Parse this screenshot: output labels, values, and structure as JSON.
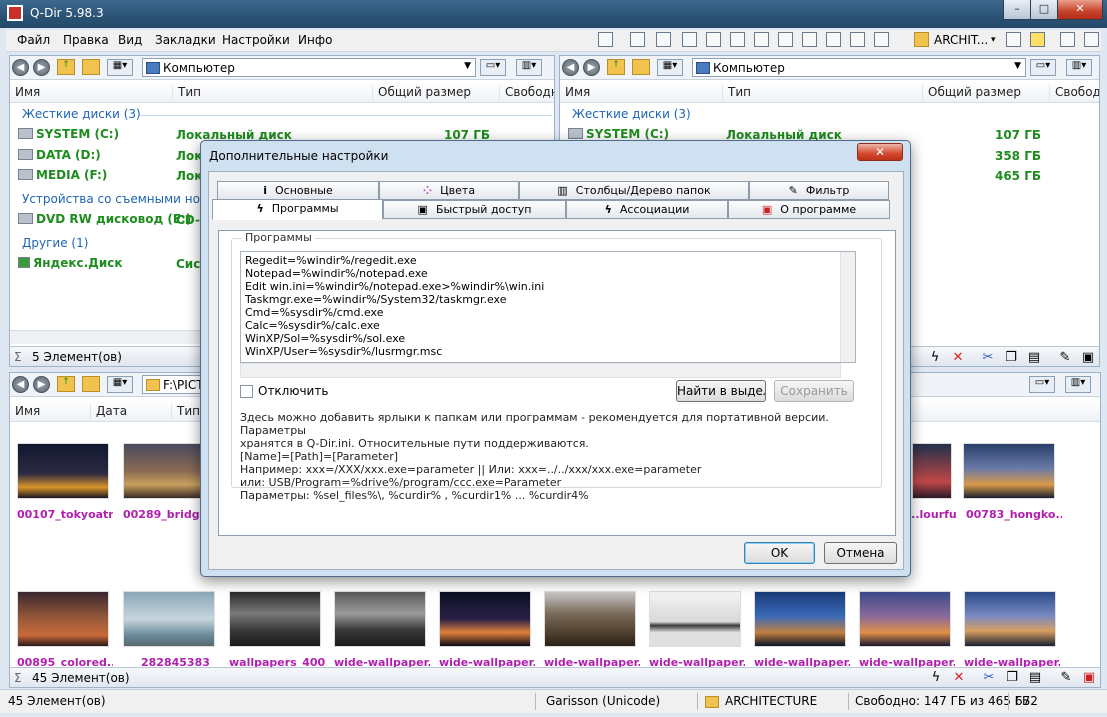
{
  "window": {
    "title": "Q-Dir 5.98.3",
    "buttons": [
      "–",
      "□",
      "✕"
    ]
  },
  "menu": [
    "Файл",
    "Правка",
    "Вид",
    "Закладки",
    "Настройки",
    "Инфо"
  ],
  "toolbar": {
    "folder_label": "ARCHIT...",
    "dropdown": "▾"
  },
  "pane_left_top": {
    "address": "Компьютер",
    "columns": [
      "Имя",
      "Тип",
      "Общий размер",
      "Свободн"
    ],
    "group_hdd": "Жесткие диски (3)",
    "group_removable": "Устройства со съемными носите",
    "group_other": "Другие (1)",
    "drives": [
      {
        "name": "SYSTEM (C:)",
        "type": "Локальный диск",
        "size": "107 ГБ"
      },
      {
        "name": "DATA (D:)",
        "type": "Лока",
        "size": ""
      },
      {
        "name": "MEDIA (F:)",
        "type": "Лока",
        "size": ""
      }
    ],
    "dvd": {
      "name": "DVD RW дисковод (E:)",
      "type": "CD-д"
    },
    "yadisk": {
      "name": "Яндекс.Диск",
      "type": "Сист"
    },
    "status": "5 Элемент(ов)"
  },
  "pane_right_top": {
    "address": "Компьютер",
    "columns": [
      "Имя",
      "Тип",
      "Общий размер",
      "Свободн"
    ],
    "group_hdd": "Жесткие диски (3)",
    "drives": [
      {
        "name": "SYSTEM (C:)",
        "type": "Локальный диск",
        "size": "107 ГБ"
      },
      {
        "name": "",
        "type": "",
        "size": "358 ГБ"
      },
      {
        "name": "",
        "type": "",
        "size": "465 ГБ"
      }
    ]
  },
  "pane_left_bottom": {
    "address": "F:\\PICT",
    "columns": [
      "Имя",
      "Дата",
      "Тип"
    ],
    "thumbs_row1": [
      "00107_tokyoatn...",
      "00289_bridges",
      "...lourful...",
      "00783_hongko..."
    ],
    "thumbs_row2": [
      "00895_colored...",
      "282845383",
      "wallpapers_400...",
      "wide-wallpaper...",
      "wide-wallpaper...",
      "wide-wallpaper...",
      "wide-wallpaper...",
      "wide-wallpaper...",
      "wide-wallpaper...",
      "wide-wallpaper..."
    ],
    "status": "45 Элемент(ов)"
  },
  "bottombar": {
    "items": "45 Элемент(ов)",
    "encoding": "Garisson (Unicode)",
    "folder": "ARCHITECTURE",
    "free": "Свободно: 147 ГБ из 465 ГБ",
    "count": "672"
  },
  "dialog": {
    "title": "Дополнительные настройки",
    "close": "✕",
    "tabs_row1": [
      "Основные",
      "Цвета",
      "Столбцы/Дерево папок",
      "Фильтр"
    ],
    "tabs_row2": [
      "Программы",
      "Быстрый доступ",
      "Ассоциации",
      "О программе"
    ],
    "group_label": "Программы",
    "program_lines": [
      "Regedit=%windir%/regedit.exe",
      "Notepad=%windir%/notepad.exe",
      "Edit win.ini=%windir%/notepad.exe>%windir%\\win.ini",
      "Taskmgr.exe=%windir%/System32/taskmgr.exe",
      "Cmd=%sysdir%/cmd.exe",
      "Calc=%sysdir%/calc.exe",
      "WinXP/Sol=%sysdir%/sol.exe",
      "WinXP/User=%sysdir%/lusrmgr.msc"
    ],
    "disable_label": "Отключить",
    "find_button": "Найти в выделе",
    "save_button": "Сохранить",
    "help_lines": [
      "Здесь можно добавить ярлыки к папкам или программам - рекомендуется для портативной версии. Параметры",
      "хранятся в Q-Dir.ini. Относительные пути поддерживаются.",
      "[Name]=[Path]=[Parameter]",
      "Например: xxx=/XXX/xxx.exe=parameter || Или: xxx=../../xxx/xxx.exe=parameter",
      " или: USB/Program=%drive%/program/ccc.exe=Parameter",
      " Параметры: %sel_files%\\, %curdir% , %curdir1% ... %curdir4%"
    ],
    "ok": "OK",
    "cancel": "Отмена"
  },
  "colors": {
    "accent": "#1e64b4",
    "drive_green": "#1e8c1e",
    "thumb_label": "#b01fae",
    "titlebar": "#2a5274"
  }
}
